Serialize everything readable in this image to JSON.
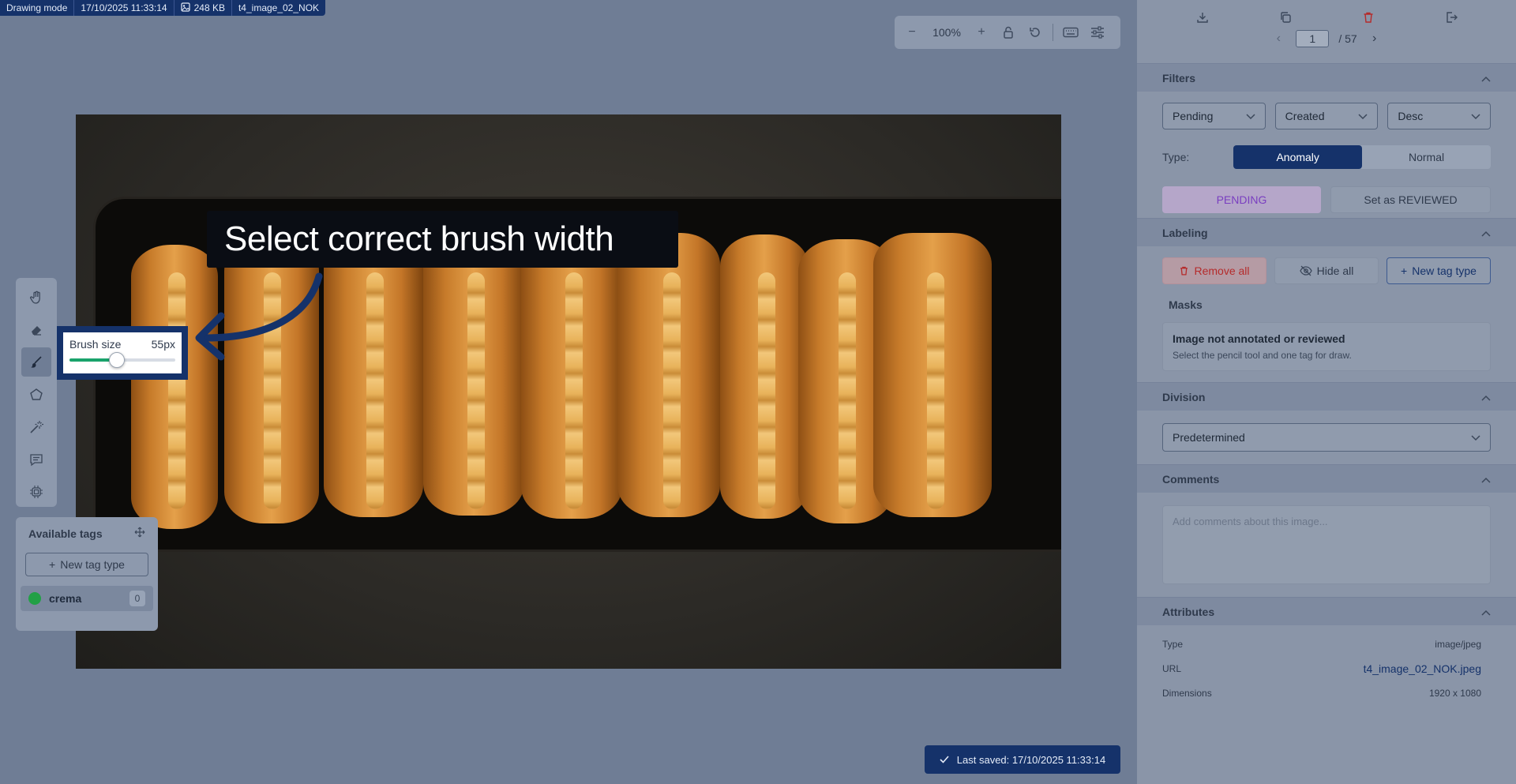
{
  "info_bar": {
    "mode": "Drawing mode",
    "datetime": "17/10/2025 11:33:14",
    "size": "248 KB",
    "filename": "t4_image_02_NOK"
  },
  "zoom": {
    "value": "100%"
  },
  "callout": {
    "text": "Select correct brush width"
  },
  "brush": {
    "label": "Brush size",
    "value": "55px",
    "level_fraction": 0.45
  },
  "toolbar": {
    "tools": [
      "hand-icon",
      "eraser-icon",
      "brush-icon",
      "polygon-icon",
      "magic-wand-icon",
      "comment-icon",
      "chip-icon"
    ],
    "active": "brush-icon"
  },
  "tags": {
    "title": "Available tags",
    "new_label": "New tag type",
    "items": [
      {
        "name": "crema",
        "count": "0",
        "color": "#22a046"
      }
    ]
  },
  "saved": {
    "text": "Last saved: 17/10/2025 11:33:14"
  },
  "pager": {
    "current": "1",
    "total": "/ 57"
  },
  "filters": {
    "title": "Filters",
    "status": "Pending",
    "sort_by": "Created",
    "order": "Desc",
    "type_label": "Type:",
    "type_options": [
      "Anomaly",
      "Normal"
    ],
    "type_selected": "Anomaly",
    "status_badge": "PENDING",
    "review_button": "Set as REVIEWED"
  },
  "labeling": {
    "title": "Labeling",
    "remove_all": "Remove all",
    "hide_all": "Hide all",
    "new_tag": "New tag type",
    "masks_title": "Masks",
    "empty_title": "Image not annotated or reviewed",
    "empty_sub": "Select the pencil tool and one tag for draw."
  },
  "division": {
    "title": "Division",
    "value": "Predetermined"
  },
  "comments": {
    "title": "Comments",
    "placeholder": "Add comments about this image..."
  },
  "attributes": {
    "title": "Attributes",
    "rows": [
      {
        "label": "Type",
        "value": "image/jpeg"
      },
      {
        "label": "URL",
        "value": "t4_image_02_NOK.jpeg"
      },
      {
        "label": "Dimensions",
        "value": "1920 x 1080"
      }
    ]
  },
  "colors": {
    "primary": "#15326a",
    "pending": "#7a3fc0",
    "danger": "#b52b2b",
    "tag": "#22a046"
  }
}
